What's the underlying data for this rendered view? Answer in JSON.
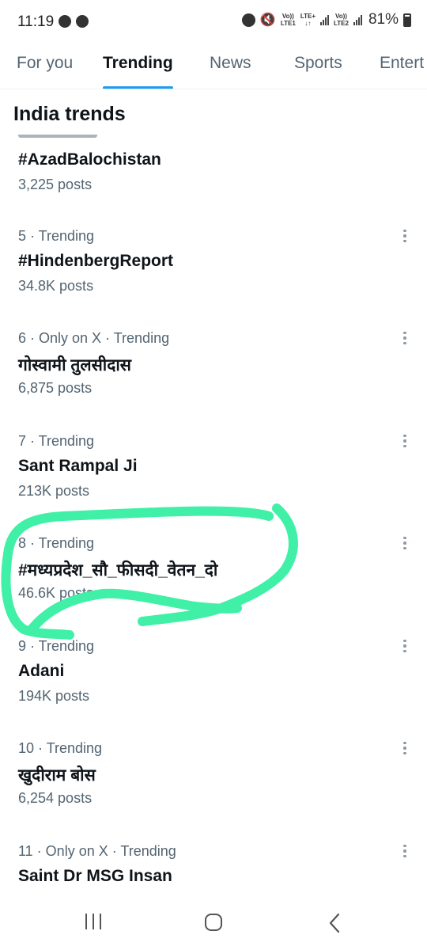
{
  "status_bar": {
    "time": "11:19",
    "lte_label": "LTE+",
    "volte1": "Vo))",
    "lte1": "LTE1",
    "volte2": "Vo))",
    "lte2": "LTE2",
    "battery": "81%",
    "icons": [
      "timer-icon",
      "whatsapp-icon",
      "alarm-icon",
      "mute-icon",
      "signal-icon",
      "battery-icon"
    ]
  },
  "tabs": [
    {
      "label": "For you",
      "active": false
    },
    {
      "label": "Trending",
      "active": true
    },
    {
      "label": "News",
      "active": false
    },
    {
      "label": "Sports",
      "active": false
    },
    {
      "label": "Entert",
      "active": false
    }
  ],
  "accent_color": "#1d9bf0",
  "highlight_color": "#3ff0a6",
  "section_title": "India trends",
  "trends": [
    {
      "meta": "",
      "name": "#AzadBalochistan",
      "count": "3,225 posts"
    },
    {
      "meta": "5 · Trending",
      "name": "#HindenbergReport",
      "count": "34.8K posts"
    },
    {
      "meta": "6 · Only on X · Trending",
      "name": "गोस्वामी तुलसीदास",
      "count": "6,875 posts"
    },
    {
      "meta": "7 · Trending",
      "name": "Sant Rampal Ji",
      "count": "213K posts"
    },
    {
      "meta": "8 · Trending",
      "name": "#मध्यप्रदेश_सौ_फीसदी_वेतन_दो",
      "count": "46.6K posts"
    },
    {
      "meta": "9 · Trending",
      "name": "Adani",
      "count": "194K posts"
    },
    {
      "meta": "10 · Trending",
      "name": "खुदीराम बोस",
      "count": "6,254 posts"
    },
    {
      "meta": "11 · Only on X · Trending",
      "name": "Saint Dr MSG Insan",
      "count": ""
    }
  ],
  "nav_icons": [
    "recents-icon",
    "home-icon",
    "back-icon"
  ]
}
